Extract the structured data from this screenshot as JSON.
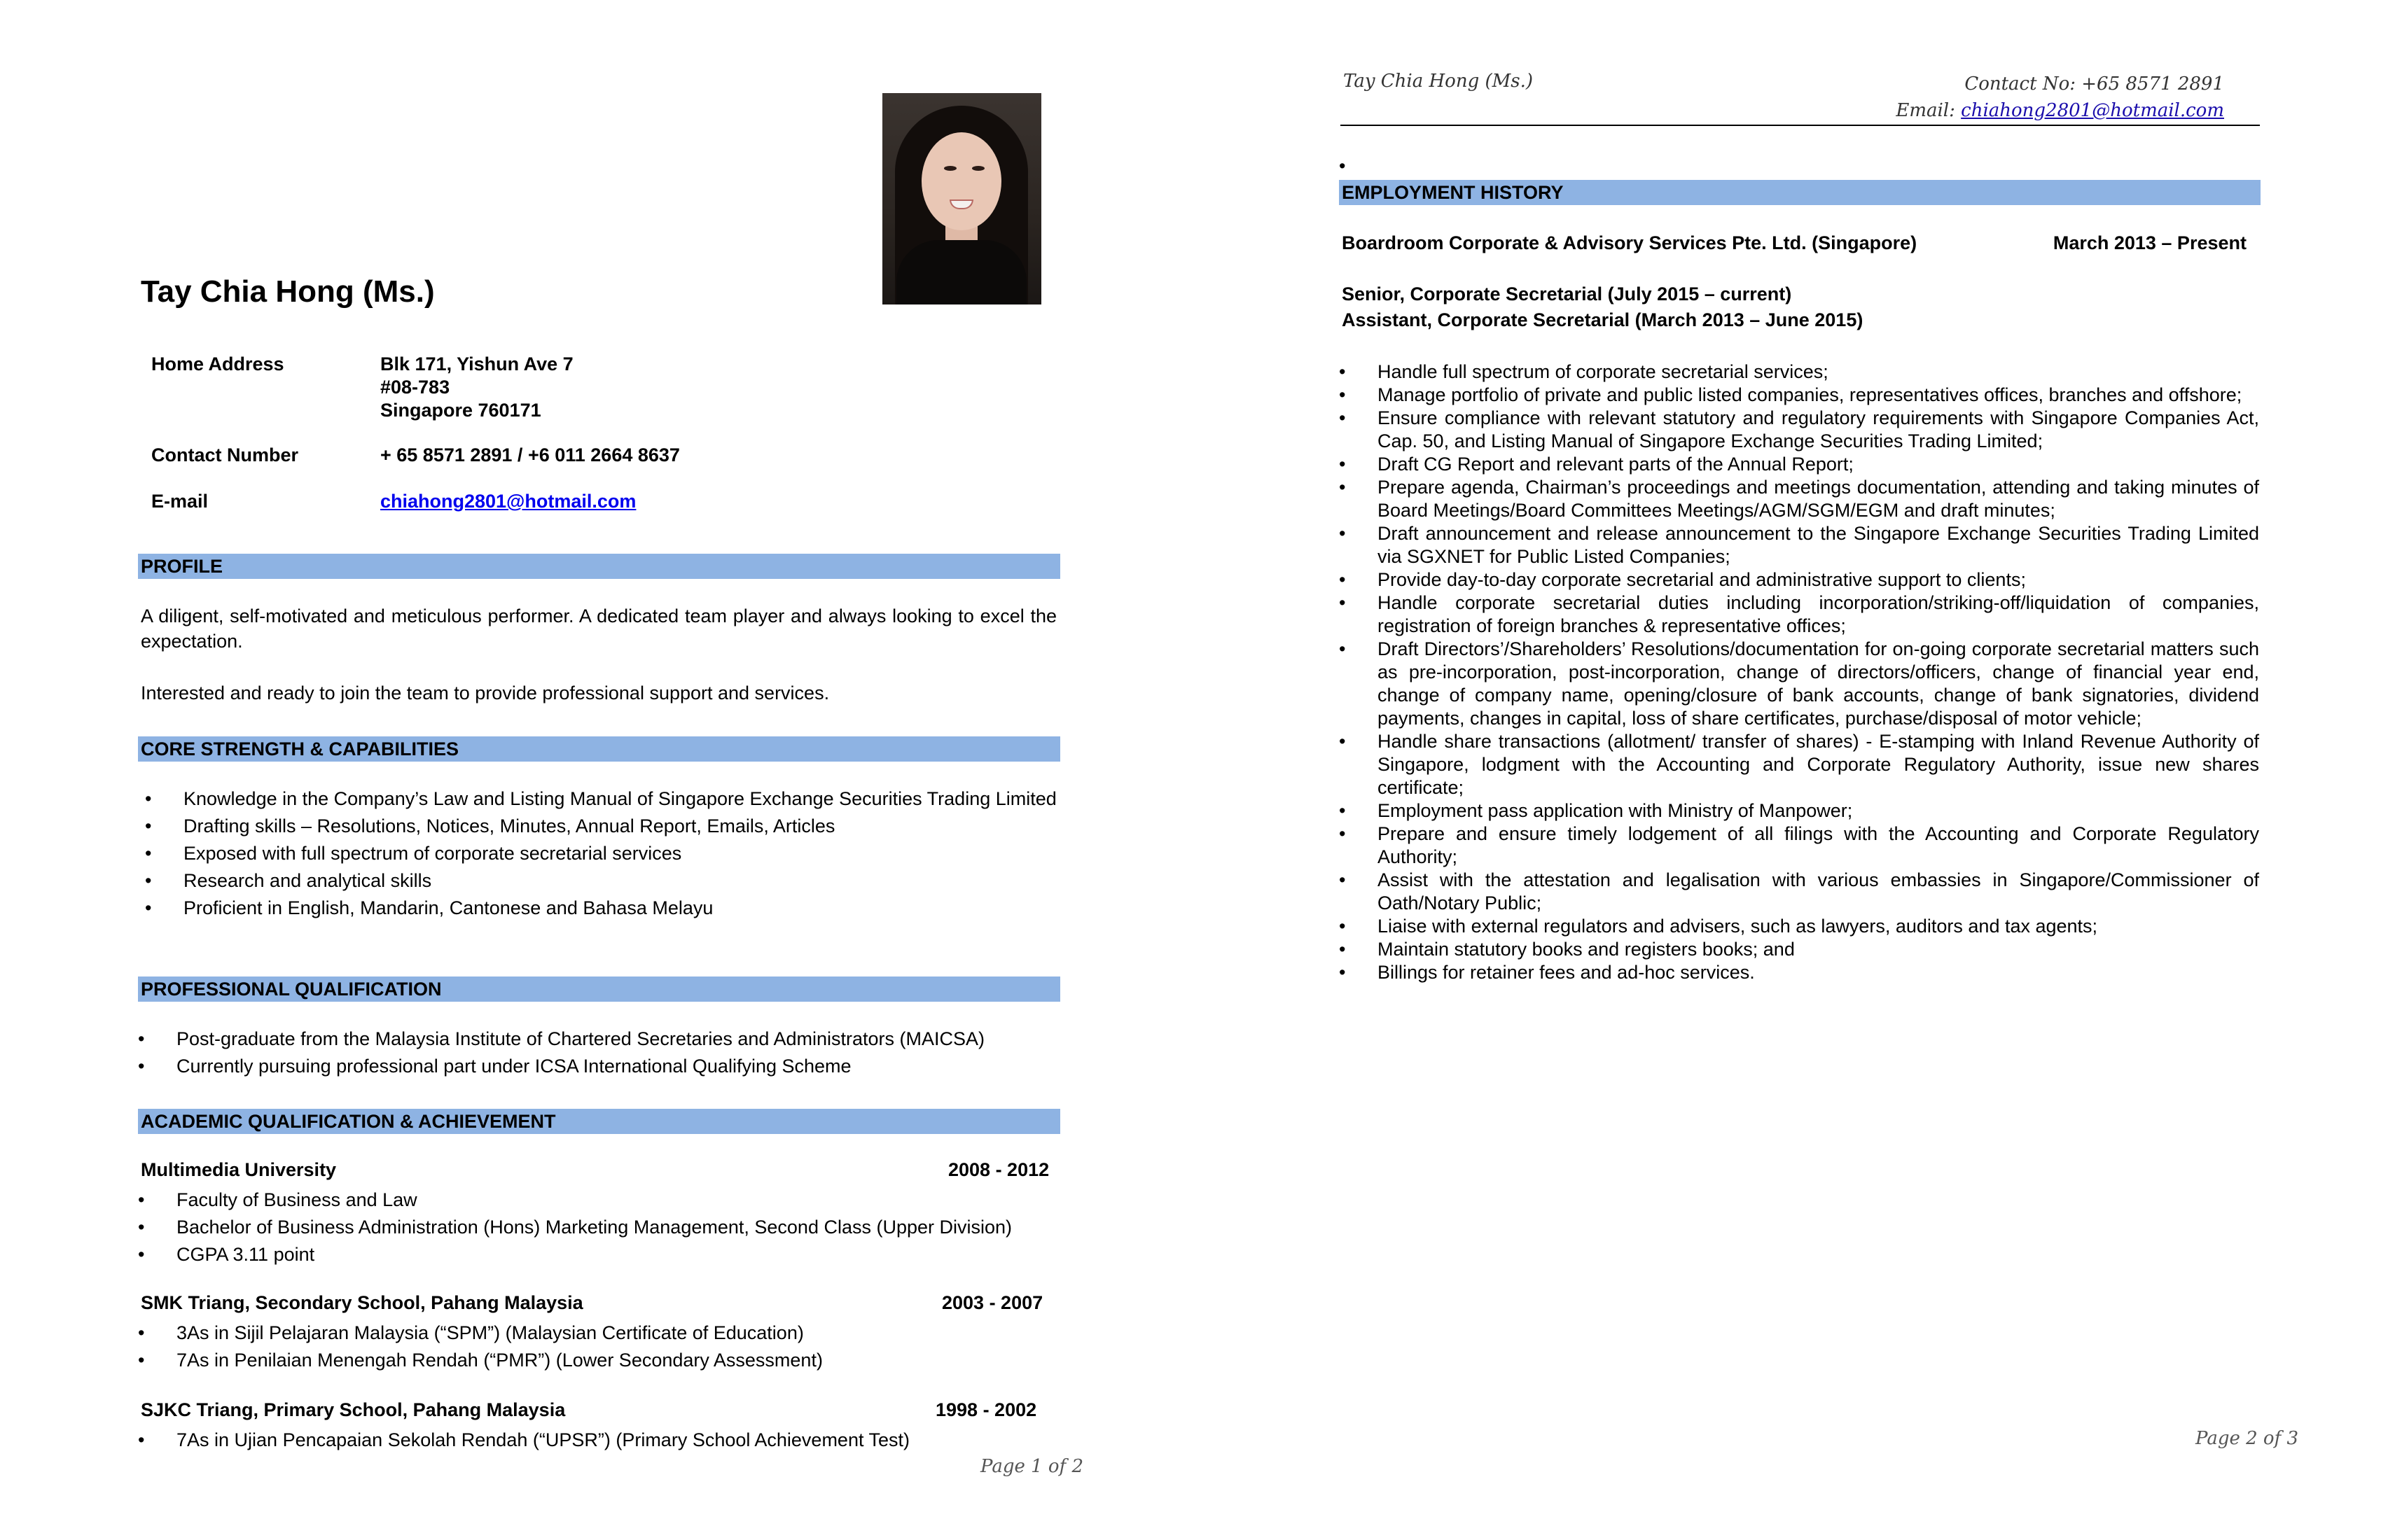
{
  "page1": {
    "name": "Tay Chia Hong (Ms.)",
    "contact": {
      "address_label": "Home Address",
      "address_line1": "Blk 171, Yishun Ave 7",
      "address_line2": "#08-783",
      "address_line3": "Singapore 760171",
      "phone_label": "Contact Number",
      "phone_value": "+ 65 8571 2891 / +6 011 2664 8637",
      "email_label": "E-mail",
      "email_value": "chiahong2801@hotmail.com"
    },
    "profile": {
      "title": "PROFILE",
      "p1": "A diligent, self-motivated and meticulous performer. A dedicated team player and always looking to excel the expectation.",
      "p2": "Interested and ready to join the team to provide professional support and services."
    },
    "strengths": {
      "title": "CORE STRENGTH & CAPABILITIES",
      "items": [
        "Knowledge in the Company’s Law and Listing Manual of Singapore Exchange Securities Trading Limited",
        "Drafting skills – Resolutions, Notices, Minutes, Annual Report, Emails, Articles",
        "Exposed with full spectrum of corporate secretarial services",
        "Research and analytical skills",
        "Proficient in English, Mandarin, Cantonese and Bahasa Melayu"
      ]
    },
    "professional": {
      "title": "PROFESSIONAL QUALIFICATION",
      "items": [
        "Post-graduate from the Malaysia Institute of Chartered Secretaries and Administrators (MAICSA)",
        "Currently pursuing professional part under ICSA International Qualifying Scheme"
      ]
    },
    "academic": {
      "title": "ACADEMIC QUALIFICATION & ACHIEVEMENT",
      "schools": [
        {
          "name": "Multimedia University",
          "years": "2008 - 2012",
          "items": [
            "Faculty of Business and Law",
            "Bachelor of Business Administration (Hons) Marketing Management, Second Class (Upper Division)",
            "CGPA 3.11 point"
          ]
        },
        {
          "name": "SMK Triang, Secondary School, Pahang Malaysia",
          "years": "2003 - 2007",
          "items": [
            "3As in Sijil Pelajaran Malaysia (“SPM”) (Malaysian Certificate of Education)",
            "7As in Penilaian Menengah Rendah (“PMR”)  (Lower Secondary Assessment)"
          ]
        },
        {
          "name": "SJKC Triang, Primary School, Pahang Malaysia",
          "years": "1998 - 2002",
          "items": [
            "7As in Ujian Pencapaian Sekolah Rendah (“UPSR”)  (Primary School Achievement Test)"
          ]
        }
      ]
    },
    "footer": "Page 1 of 2"
  },
  "page2": {
    "header_name": "Tay Chia Hong (Ms.)",
    "header_contact": "Contact No: +65 8571 2891",
    "header_email_label": "Email: ",
    "header_email": "chiahong2801@hotmail.com",
    "stray_bullet": "•",
    "section_title": "EMPLOYMENT HISTORY",
    "company": "Boardroom Corporate & Advisory Services Pte. Ltd. (Singapore)",
    "dates": "March 2013 – Present",
    "role1": "Senior, Corporate Secretarial (July 2015 – current)",
    "role2": "Assistant, Corporate Secretarial (March 2013 – June 2015)",
    "duties": [
      "Handle full spectrum of corporate secretarial services;",
      "Manage portfolio of private and public listed companies, representatives offices, branches and offshore;",
      "Ensure compliance with relevant statutory and regulatory requirements with Singapore Companies Act, Cap. 50, and Listing Manual of Singapore Exchange Securities Trading Limited;",
      "Draft CG Report and relevant parts of the Annual Report;",
      "Prepare agenda, Chairman’s proceedings and meetings documentation, attending and taking minutes of Board Meetings/Board Committees Meetings/AGM/SGM/EGM and draft minutes;",
      "Draft announcement and release announcement to the Singapore Exchange Securities Trading Limited via SGXNET for Public Listed Companies;",
      "Provide day-to-day corporate secretarial and administrative support to clients;",
      "Handle corporate secretarial duties including incorporation/striking-off/liquidation of companies, registration of foreign branches & representative offices;",
      "Draft Directors’/Shareholders’ Resolutions/documentation for on-going corporate secretarial matters such as pre-incorporation, post-incorporation, change of directors/officers, change of financial year end, change of company name, opening/closure of bank accounts, change of bank signatories, dividend payments, changes in capital, loss of share certificates, purchase/disposal of motor vehicle;",
      "Handle share transactions (allotment/ transfer of shares) - E-stamping with Inland Revenue Authority of Singapore, lodgment with the Accounting and Corporate Regulatory Authority, issue new shares certificate;",
      "Employment pass application with Ministry of Manpower;",
      "Prepare and ensure timely lodgement of all filings with the Accounting and Corporate Regulatory Authority;",
      "Assist with the attestation and legalisation with various embassies in Singapore/Commissioner of Oath/Notary Public;",
      "Liaise with external regulators and advisers, such as lawyers, auditors and tax agents;",
      "Maintain statutory books and registers books; and",
      "Billings for retainer fees and ad-hoc services."
    ],
    "footer": "Page 2 of 3"
  }
}
